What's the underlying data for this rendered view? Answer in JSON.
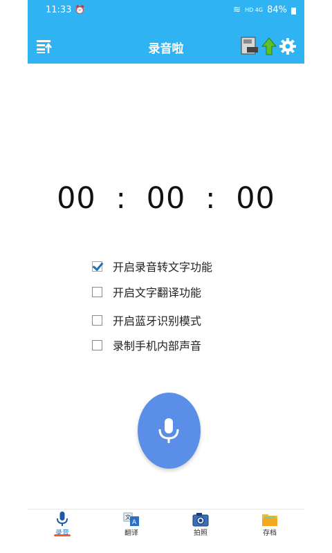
{
  "status": {
    "time": "11:33",
    "alarm_glyph": "t’U",
    "signal": "HD 4G",
    "battery": "84%"
  },
  "header": {
    "title": "录音啦"
  },
  "timer": {
    "hours": "00",
    "minutes": "00",
    "seconds": "00",
    "separator": ":"
  },
  "options": [
    {
      "label": "开启录音转文字功能",
      "checked": true
    },
    {
      "label": "开启文字翻译功能",
      "checked": false
    },
    {
      "label": "开启蓝牙识别模式",
      "checked": false
    },
    {
      "label": "录制手机内部声音",
      "checked": false
    }
  ],
  "tabs": [
    {
      "label": "录音",
      "icon": "microphone-icon",
      "active": true
    },
    {
      "label": "翻译",
      "icon": "translate-icon",
      "active": false
    },
    {
      "label": "拍照",
      "icon": "camera-icon",
      "active": false
    },
    {
      "label": "存档",
      "icon": "folder-icon",
      "active": false
    }
  ],
  "colors": {
    "header": "#2fb3f2",
    "mic_button": "#5b8ee6",
    "tab_indicator": "#ff5722",
    "active_tab": "#2a78c8"
  }
}
